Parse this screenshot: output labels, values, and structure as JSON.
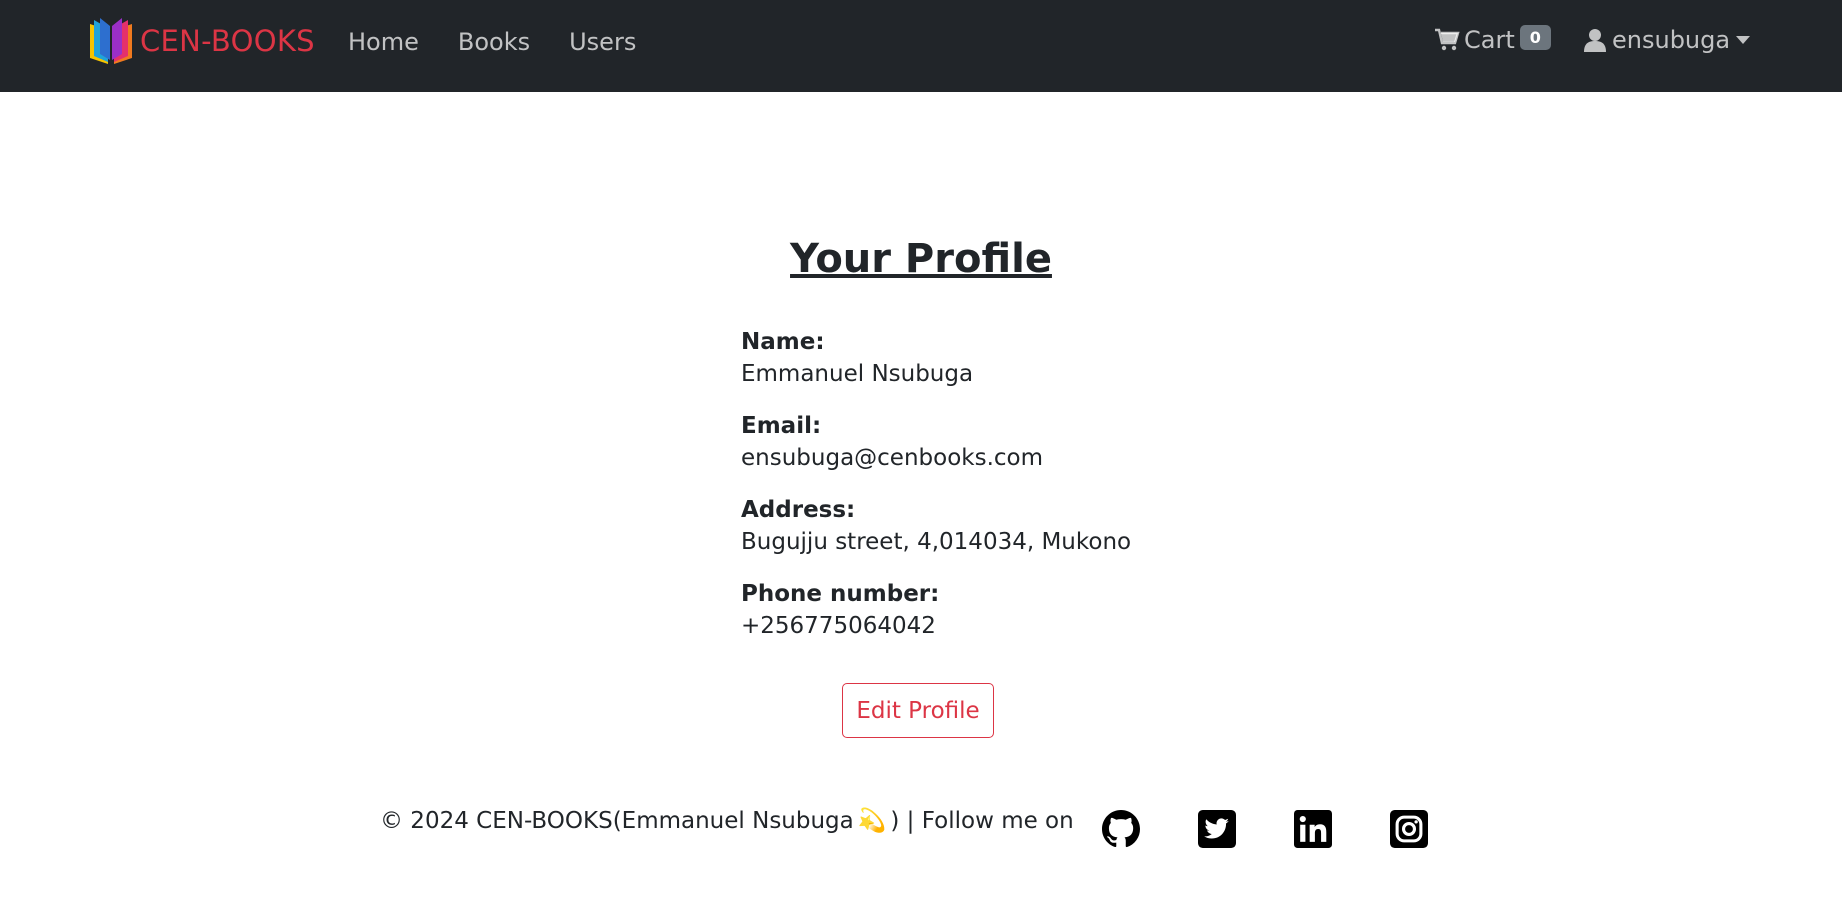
{
  "brand": {
    "name": "CEN-BOOKS",
    "icon": "book-logo-icon"
  },
  "nav": {
    "links": [
      {
        "label": "Home"
      },
      {
        "label": "Books"
      },
      {
        "label": "Users"
      }
    ],
    "cart": {
      "label": "Cart",
      "count": "0",
      "icon": "cart-icon"
    },
    "user": {
      "label": "ensubuga",
      "icon": "user-icon"
    }
  },
  "profile": {
    "title": "Your Profile",
    "fields": [
      {
        "label": "Name:",
        "value": "Emmanuel Nsubuga"
      },
      {
        "label": "Email:",
        "value": "ensubuga@cenbooks.com"
      },
      {
        "label": "Address:",
        "value": "Bugujju street, 4,014034, Mukono"
      },
      {
        "label": "Phone number:",
        "value": "+256775064042"
      }
    ],
    "edit_label": "Edit Profile"
  },
  "footer": {
    "text_before": "© 2024 CEN-BOOKS(Emmanuel Nsubuga",
    "sparkle": "💫",
    "text_after": ") | Follow me on",
    "social": [
      "github-icon",
      "twitter-icon",
      "linkedin-icon",
      "instagram-icon"
    ]
  },
  "colors": {
    "navbar": "#212529",
    "brand": "#dc3545",
    "badge": "#6c757d"
  }
}
